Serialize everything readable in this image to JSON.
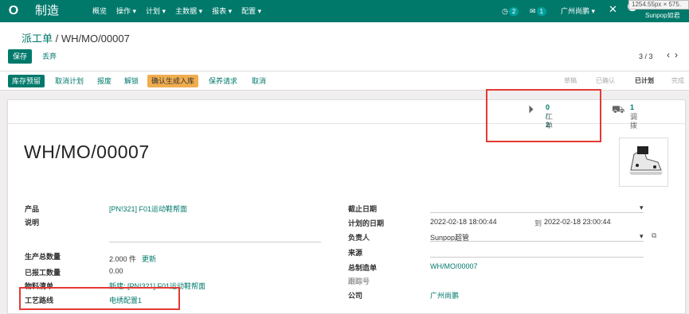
{
  "topbar": {
    "logo": "O",
    "app_name": "制造",
    "menu": [
      "概览",
      "操作 ▾",
      "计划 ▾",
      "主数据 ▾",
      "报表 ▾",
      "配置 ▾"
    ],
    "activity_count": "2",
    "message_count": "1",
    "company": "广州尚鹏 ▾",
    "user": "Sunpop如君"
  },
  "dimension_tag": "1254.55px × 575.",
  "breadcrumb": {
    "parent": "派工单",
    "sep": " / ",
    "current": "WH/MO/00007"
  },
  "actions": {
    "save": "保存",
    "discard": "丢弃"
  },
  "pager": {
    "value": "3 / 3"
  },
  "status_buttons": [
    "库存预留",
    "取消计划",
    "报废",
    "解锁",
    "确认生成入库",
    "保养请求",
    "取消"
  ],
  "stages": [
    "草稿",
    "已确认",
    "已计划",
    "完成"
  ],
  "active_stage": "已计划",
  "smart_buttons": [
    {
      "value": "0 / 2",
      "label": "工单",
      "icon": "play-icon"
    },
    {
      "value": "1",
      "label": "调拨",
      "icon": "truck-icon"
    }
  ],
  "record_title": "WH/MO/00007",
  "left_fields": {
    "product_label": "产品",
    "product_value": "[PN!321] F01运动鞋帮面",
    "desc_label": "说明",
    "qty_label": "生产总数量",
    "qty_value": "2.000 件",
    "qty_update": "更新",
    "reported_label": "已报工数量",
    "reported_value": "0.00",
    "bom_label": "物料清单",
    "bom_value": "新建: [PN!321] F01运动鞋帮面",
    "route_label": "工艺路线",
    "route_value": "电绣配置1"
  },
  "right_fields": {
    "deadline_label": "截止日期",
    "planned_label": "计划的日期",
    "planned_start": "2022-02-18 18:00:44",
    "planned_to": "到",
    "planned_end": "2022-02-18 23:00:44",
    "responsible_label": "负责人",
    "responsible_value": "Sunpop超管",
    "source_label": "来源",
    "master_label": "总制造单",
    "master_value": "WH/MO/00007",
    "tracking_label": "跟踪号",
    "company_label": "公司",
    "company_value": "广州尚鹏"
  }
}
